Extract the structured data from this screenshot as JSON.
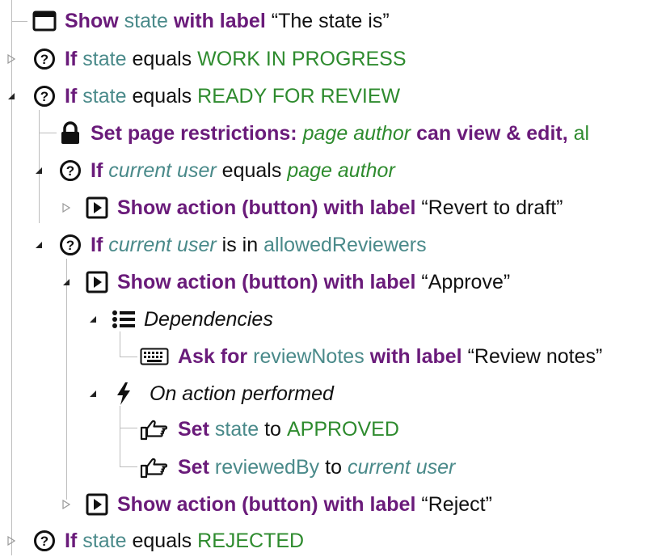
{
  "rows": [
    {
      "parts": [
        "Show",
        "state",
        "with label",
        "“The state is”"
      ]
    },
    {
      "parts": [
        "If",
        "state",
        "equals",
        "WORK IN PROGRESS"
      ]
    },
    {
      "parts": [
        "If",
        "state",
        "equals",
        "READY FOR REVIEW"
      ]
    },
    {
      "parts": [
        "Set page restrictions:",
        "page author",
        "can view & edit,",
        "al"
      ]
    },
    {
      "parts": [
        "If",
        "current user",
        "equals",
        "page author"
      ]
    },
    {
      "parts": [
        "Show action (button) with label",
        "“Revert to draft”"
      ]
    },
    {
      "parts": [
        "If",
        "current user",
        "is in",
        "allowedReviewers"
      ]
    },
    {
      "parts": [
        "Show action (button) with label",
        "“Approve”"
      ]
    },
    {
      "parts": [
        "Dependencies"
      ]
    },
    {
      "parts": [
        "Ask for",
        "reviewNotes",
        "with label",
        "“Review notes”"
      ]
    },
    {
      "parts": [
        "On action performed"
      ]
    },
    {
      "parts": [
        "Set",
        "state",
        "to",
        "APPROVED"
      ]
    },
    {
      "parts": [
        "Set",
        "reviewedBy",
        "to",
        "current user"
      ]
    },
    {
      "parts": [
        "Show action (button) with label",
        "“Reject”"
      ]
    },
    {
      "parts": [
        "If",
        "state",
        "equals",
        "REJECTED"
      ]
    }
  ],
  "icons": [
    "window-icon",
    "question-icon",
    "lock-icon",
    "play-button-icon",
    "list-icon",
    "keyboard-icon",
    "lightning-icon",
    "pointing-hand-icon"
  ],
  "colors": {
    "keyword": "#6a1b7a",
    "variable": "#4a8a8a",
    "value": "#2e8b2e",
    "guide": "#bdbdbd"
  }
}
